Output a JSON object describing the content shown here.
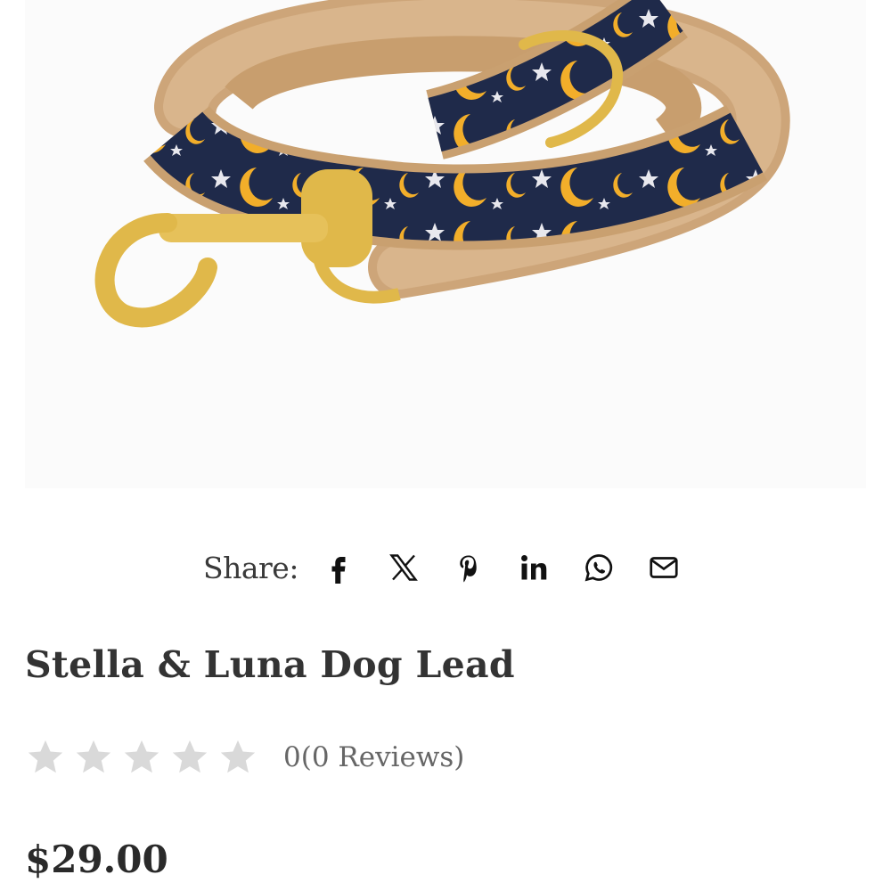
{
  "product": {
    "image_alt": "Stella & Luna Dog Lead",
    "title": "Stella & Luna Dog Lead",
    "rating": 0,
    "rating_max": 5,
    "reviews_text": "0(0 Reviews)",
    "price": "$29.00"
  },
  "share": {
    "label": "Share:",
    "icons": [
      "facebook-icon",
      "x-twitter-icon",
      "pinterest-icon",
      "linkedin-icon",
      "whatsapp-icon",
      "email-icon"
    ]
  },
  "colors": {
    "lead_navy": "#1f2a4a",
    "moon_gold": "#f2ae2a",
    "webbing_tan": "#d2a979",
    "brass": "#e0b84a",
    "star_empty": "#d9d9d9"
  }
}
